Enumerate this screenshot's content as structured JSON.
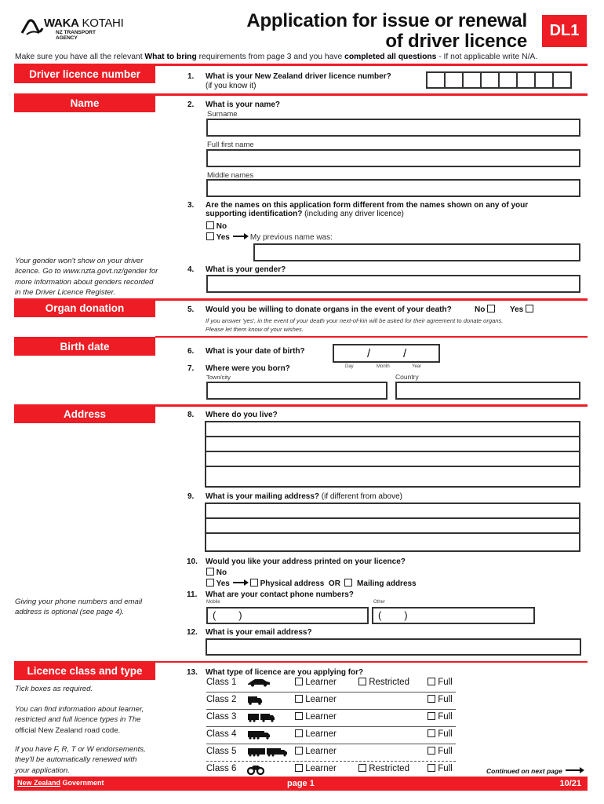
{
  "header": {
    "logo_brand_bold": "WAKA",
    "logo_brand_rest": "KOTAHI",
    "logo_sub_line1": "NZ TRANSPORT",
    "logo_sub_line2": "AGENCY",
    "title_line1": "Application for issue or renewal",
    "title_line2": "of driver licence",
    "form_code": "DL1",
    "intro_part1": "Make sure you have all the relevant ",
    "intro_bold1": "What to bring",
    "intro_part2": " requirements from page 3 and you have ",
    "intro_bold2": "completed all questions",
    "intro_part3": " - If not applicable write N/A."
  },
  "brand_color": "#ee1c24",
  "sections": {
    "driver_licence_number": "Driver licence number",
    "name": "Name",
    "organ_donation": "Organ donation",
    "birth_date": "Birth date",
    "address": "Address",
    "licence_class": "Licence class and type"
  },
  "side_notes": {
    "gender": [
      "Your gender won't show on your driver",
      "licence. Go to www.nzta.govt.nz/gender for",
      "more information about genders recorded",
      "in the Driver Licence Register."
    ],
    "contact": [
      "Giving your phone numbers and email",
      "address is optional (see page 4)."
    ],
    "tick": "Tick boxes as required.",
    "info": [
      "You can find information about learner,",
      "restricted and full licence types in The",
      "official New Zealand road code."
    ],
    "endorse": [
      "If you have F, R, T or W endorsements,",
      "they'll be automatically renewed with",
      "your application."
    ]
  },
  "questions": {
    "q1": {
      "num": "1.",
      "text": "What is your New Zealand driver licence number?",
      "hint": "(if you know it)",
      "digit_count": 8
    },
    "q2": {
      "num": "2.",
      "text": "What is your name?",
      "surname": "Surname",
      "first": "Full first name",
      "middle": "Middle names"
    },
    "q3": {
      "num": "3.",
      "text1": "Are the names on this application form different from the names shown on any of your",
      "text2": "supporting identification?",
      "hint": " (including any driver licence)",
      "no": "No",
      "yes": "Yes",
      "prev": "My previous name was:"
    },
    "q4": {
      "num": "4.",
      "text": "What is your gender?"
    },
    "q5": {
      "num": "5.",
      "text": "Would you be willing to donate organs in the event of your death?",
      "no": "No",
      "yes": "Yes",
      "note1": "If you answer 'yes', in the event of your death your next-of-kin will be asked for their agreement to donate organs.",
      "note2": "Please let them know of your wishes."
    },
    "q6": {
      "num": "6.",
      "text": "What is your date of birth?",
      "sep": "/",
      "day": "Day",
      "month": "Month",
      "year": "Year"
    },
    "q7": {
      "num": "7.",
      "text": "Where were you born?",
      "town": "Town/city",
      "country": "Country"
    },
    "q8": {
      "num": "8.",
      "text": "Where do you live?"
    },
    "q9": {
      "num": "9.",
      "text": "What is your mailing address?",
      "hint": " (if different from above)"
    },
    "q10": {
      "num": "10.",
      "text": "Would you like your address printed on your licence?",
      "no": "No",
      "yes": "Yes",
      "physical": "Physical address",
      "or": "OR",
      "mailing": "Mailing address"
    },
    "q11": {
      "num": "11.",
      "text": "What are your contact phone numbers?",
      "mobile": "Mobile",
      "other": "Other",
      "paren": "(        )"
    },
    "q12": {
      "num": "12.",
      "text": "What is your email address?"
    },
    "q13": {
      "num": "13.",
      "text": "What type of licence are you applying for?"
    }
  },
  "licence_classes": [
    {
      "label": "Class 1",
      "vehicle_icon": "car-icon",
      "learner": "Learner",
      "restricted": "Restricted",
      "full": "Full"
    },
    {
      "label": "Class 2",
      "vehicle_icon": "truck-icon",
      "learner": "Learner",
      "restricted": null,
      "full": "Full"
    },
    {
      "label": "Class 3",
      "vehicle_icon": "truck-trailer-icon",
      "learner": "Learner",
      "restricted": null,
      "full": "Full"
    },
    {
      "label": "Class 4",
      "vehicle_icon": "heavy-truck-icon",
      "learner": "Learner",
      "restricted": null,
      "full": "Full"
    },
    {
      "label": "Class 5",
      "vehicle_icon": "heavy-combination-icon",
      "learner": "Learner",
      "restricted": null,
      "full": "Full"
    },
    {
      "label": "Class 6",
      "vehicle_icon": "motorcycle-icon",
      "learner": "Learner",
      "restricted": "Restricted",
      "full": "Full"
    }
  ],
  "footer": {
    "gov_part1": "New Zealand",
    "gov_part2": " Government",
    "page": "page 1",
    "version": "10/21",
    "continued": "Continued on next page"
  }
}
